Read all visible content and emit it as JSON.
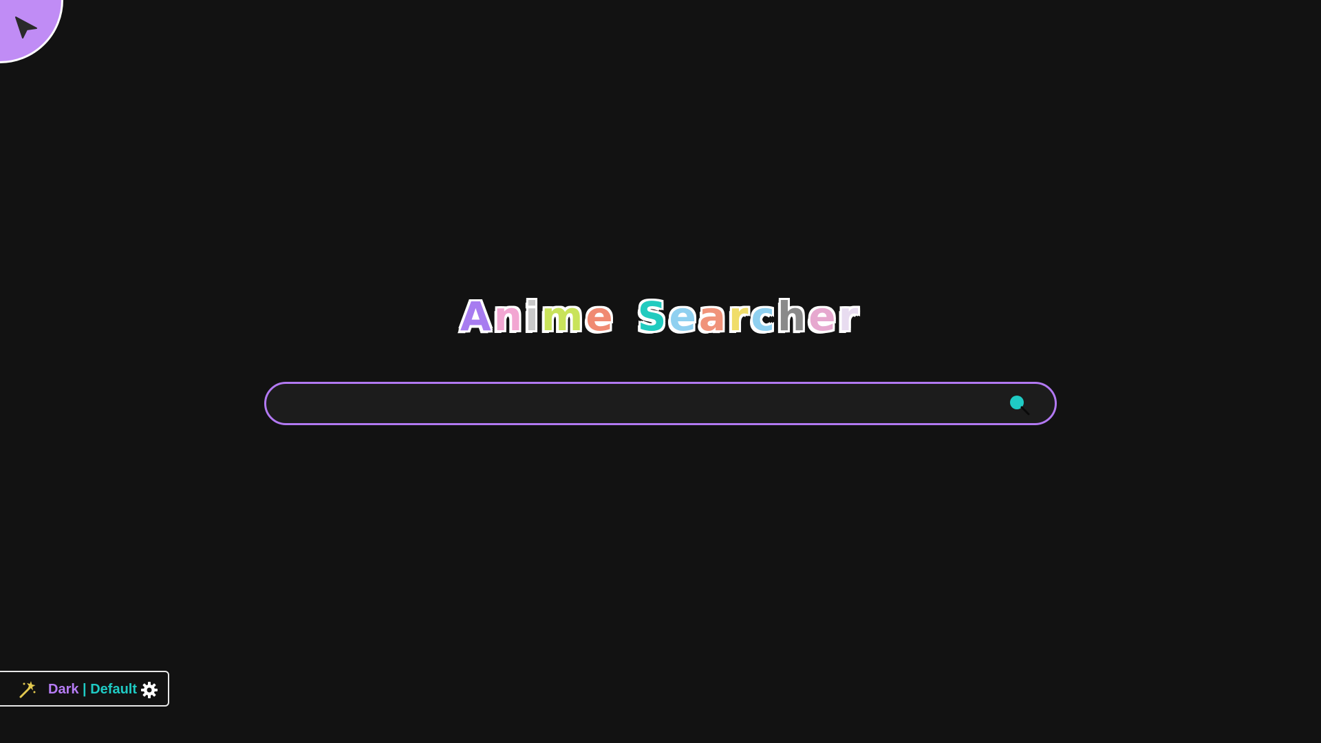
{
  "title": {
    "text": "Anime Searcher",
    "letters": [
      {
        "char": "A",
        "color": "#a77cf0"
      },
      {
        "char": "n",
        "color": "#f2a6d2"
      },
      {
        "char": "i",
        "color": "#c8c8c8"
      },
      {
        "char": "m",
        "color": "#c9e35a"
      },
      {
        "char": "e",
        "color": "#f08a72"
      },
      {
        "char": " ",
        "color": ""
      },
      {
        "char": "S",
        "color": "#21cbbf"
      },
      {
        "char": "e",
        "color": "#8fd0f0"
      },
      {
        "char": "a",
        "color": "#f0937a"
      },
      {
        "char": "r",
        "color": "#f0dd6a"
      },
      {
        "char": "c",
        "color": "#8fd0f0"
      },
      {
        "char": "h",
        "color": "#8a8a8a"
      },
      {
        "char": "e",
        "color": "#e6a8cf"
      },
      {
        "char": "r",
        "color": "#e8dcf0"
      }
    ]
  },
  "search": {
    "value": "",
    "placeholder": "",
    "border_color": "#b279f2",
    "icon": "search-icon",
    "icon_color": "#1fcbc4"
  },
  "corner_button": {
    "icon": "cursor-arrow-icon",
    "color": "#c08cf5"
  },
  "theme": {
    "mode_label": "Dark",
    "separator": "|",
    "theme_label": "Default",
    "wand_icon": "magic-wand-icon",
    "settings_icon": "gear-icon",
    "mode_color": "#b67cf5",
    "theme_color": "#1fcbc4",
    "wand_color": "#e2c94f"
  }
}
